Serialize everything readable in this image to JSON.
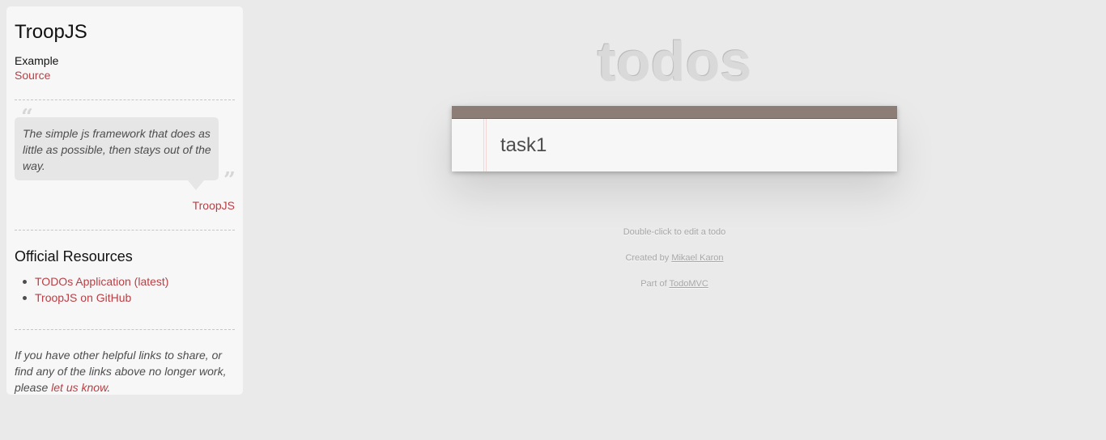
{
  "sidebar": {
    "title": "TroopJS",
    "subtitle": "Example",
    "source_link": "Source",
    "quote": {
      "text": "The simple js framework that does as little as possible, then stays out of the way.",
      "author": "TroopJS"
    },
    "resources_heading": "Official Resources",
    "resources": [
      {
        "label": "TODOs Application (latest)"
      },
      {
        "label": "TroopJS on GitHub"
      }
    ],
    "footer": {
      "prefix": "If you have other helpful links to share, or find any of the links above no longer work, please ",
      "link": "let us know",
      "suffix": "."
    }
  },
  "app": {
    "title": "todos",
    "new_todo_value": "task1"
  },
  "info": {
    "hint": "Double-click to edit a todo",
    "created_prefix": "Created by ",
    "created_author": "Mikael Karon",
    "part_prefix": "Part of ",
    "part_link": "TodoMVC"
  },
  "colors": {
    "accent": "#b83f45",
    "header_bar": "#8d7d77",
    "background": "#eaeaea"
  }
}
